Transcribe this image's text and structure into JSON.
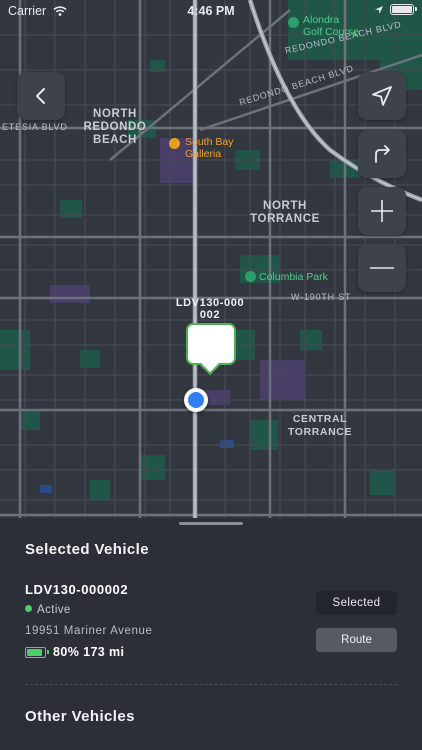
{
  "status_bar": {
    "carrier": "Carrier",
    "time": "4:46 PM"
  },
  "map": {
    "areas": [
      {
        "id": "north-redondo",
        "text": "NORTH\nREDONDO\nBEACH"
      },
      {
        "id": "north-torrance",
        "text": "NORTH\nTORRANCE"
      },
      {
        "id": "central-torrance",
        "text": "CENTRAL\nTORRANCE"
      }
    ],
    "roads": {
      "redondo_beach_blvd_1": "REDONDO BEACH BLVD",
      "redondo_beach_blvd_2": "REDONDO BEACH BLVD",
      "artesia_blvd": "ETESIA BLVD",
      "w190th": "W-190TH ST"
    },
    "pois": {
      "galleria": "South Bay\nGalleria",
      "golf": "Alondra\nGolf Course",
      "park": "Columbia Park"
    },
    "vehicle_marker_label": "LDV130-000\n002"
  },
  "sheet": {
    "selected_title": "Selected Vehicle",
    "vehicle": {
      "name": "LDV130-000002",
      "status": "Active",
      "address": "19951 Mariner Avenue",
      "battery": "80% 173 mi",
      "battery_level": 0.8
    },
    "selected_button": "Selected",
    "route_button": "Route",
    "other_title": "Other Vehicles"
  },
  "colors": {
    "accent_green": "#4ccf6a",
    "location_blue": "#2f7ff0",
    "galleria_orange": "#e8a020"
  }
}
